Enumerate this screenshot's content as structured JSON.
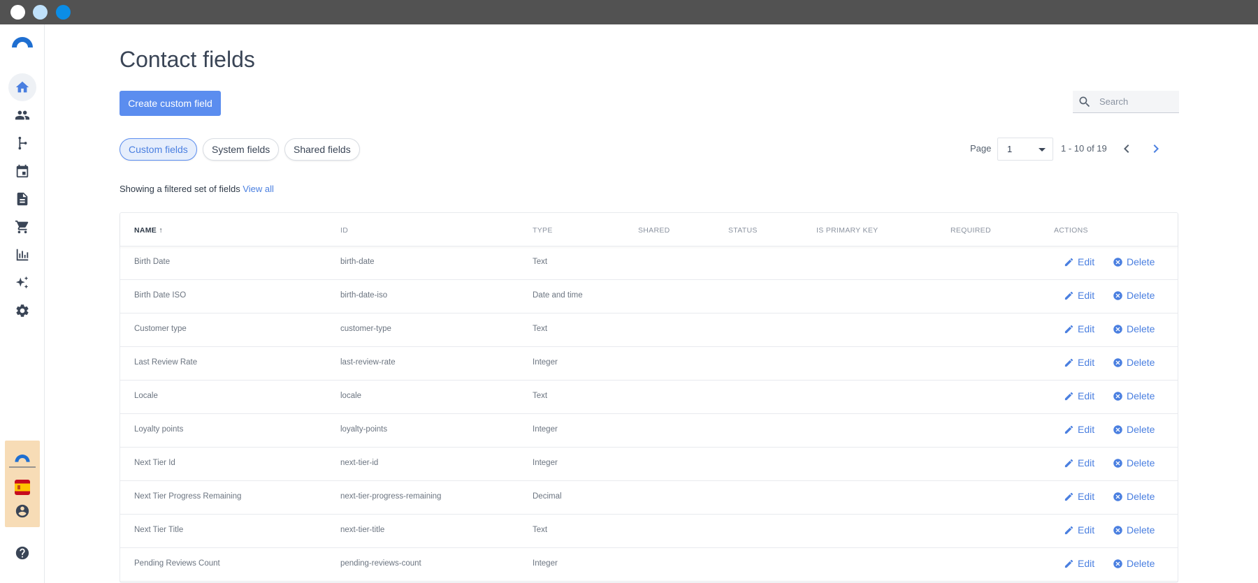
{
  "page": {
    "title": "Contact fields",
    "create_button": "Create custom field",
    "search_placeholder": "Search"
  },
  "tabs": [
    {
      "label": "Custom fields",
      "active": true
    },
    {
      "label": "System fields",
      "active": false
    },
    {
      "label": "Shared fields",
      "active": false
    }
  ],
  "pager": {
    "label": "Page",
    "current": "1",
    "range": "1 - 10 of 19"
  },
  "filter_note": {
    "text": "Showing a filtered set of fields",
    "link": "View all"
  },
  "table": {
    "columns": [
      "NAME",
      "ID",
      "TYPE",
      "SHARED",
      "STATUS",
      "IS PRIMARY KEY",
      "REQUIRED",
      "ACTIONS"
    ],
    "sort_indicator": "↑",
    "rows": [
      {
        "name": "Birth Date",
        "id": "birth-date",
        "type": "Text"
      },
      {
        "name": "Birth Date ISO",
        "id": "birth-date-iso",
        "type": "Date and time"
      },
      {
        "name": "Customer type",
        "id": "customer-type",
        "type": "Text"
      },
      {
        "name": "Last Review Rate",
        "id": "last-review-rate",
        "type": "Integer"
      },
      {
        "name": "Locale",
        "id": "locale",
        "type": "Text"
      },
      {
        "name": "Loyalty points",
        "id": "loyalty-points",
        "type": "Integer"
      },
      {
        "name": "Next Tier Id",
        "id": "next-tier-id",
        "type": "Integer"
      },
      {
        "name": "Next Tier Progress Remaining",
        "id": "next-tier-progress-remaining",
        "type": "Decimal"
      },
      {
        "name": "Next Tier Title",
        "id": "next-tier-title",
        "type": "Text"
      },
      {
        "name": "Pending Reviews Count",
        "id": "pending-reviews-count",
        "type": "Integer"
      }
    ],
    "edit_label": "Edit",
    "delete_label": "Delete"
  },
  "sidebar": {
    "items": [
      {
        "icon": "home-icon",
        "active": true
      },
      {
        "icon": "contacts-icon",
        "active": false
      },
      {
        "icon": "journeys-icon",
        "active": false
      },
      {
        "icon": "calendar-icon",
        "active": false
      },
      {
        "icon": "document-icon",
        "active": false
      },
      {
        "icon": "cart-icon",
        "active": false
      },
      {
        "icon": "analytics-icon",
        "active": false
      },
      {
        "icon": "sparkle-icon",
        "active": false
      },
      {
        "icon": "settings-icon",
        "active": false
      }
    ],
    "bottom": [
      "account-icon",
      "help-icon"
    ]
  },
  "colors": {
    "accent": "#5b8def",
    "link": "#4a7fe0",
    "titlebar": "#525252",
    "org_box": "#f7dcb6"
  }
}
